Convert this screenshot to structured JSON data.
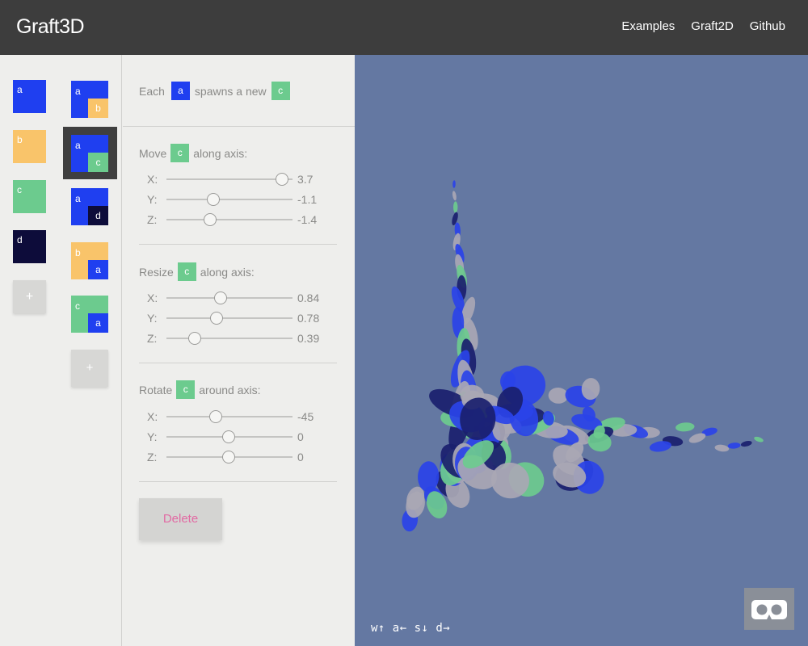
{
  "app": {
    "title": "Graft3D"
  },
  "nav": {
    "examples": "Examples",
    "graft2d": "Graft2D",
    "github": "Github"
  },
  "shapes": [
    {
      "label": "a",
      "color": "#1f3ff0"
    },
    {
      "label": "b",
      "color": "#f9c46a"
    },
    {
      "label": "c",
      "color": "#6ccb8e"
    },
    {
      "label": "d",
      "color": "#0d0c3a"
    }
  ],
  "add_shape_label": "+",
  "rules": [
    {
      "parent": "a",
      "child": "b"
    },
    {
      "parent": "a",
      "child": "c",
      "selected": true
    },
    {
      "parent": "a",
      "child": "d"
    },
    {
      "parent": "b",
      "child": "a"
    },
    {
      "parent": "c",
      "child": "a"
    }
  ],
  "add_rule_label": "+",
  "editor": {
    "each_text": "Each",
    "spawns_text": "spawns a new",
    "parent": "a",
    "child": "c",
    "move": {
      "title_pre": "Move",
      "title_post": "along axis:",
      "x": {
        "label": "X:",
        "value": "3.7"
      },
      "y": {
        "label": "Y:",
        "value": "-1.1"
      },
      "z": {
        "label": "Z:",
        "value": "-1.4"
      }
    },
    "resize": {
      "title_pre": "Resize",
      "title_post": "along axis:",
      "x": {
        "label": "X:",
        "value": "0.84"
      },
      "y": {
        "label": "Y:",
        "value": "0.78"
      },
      "z": {
        "label": "Z:",
        "value": "0.39"
      }
    },
    "rotate": {
      "title_pre": "Rotate",
      "title_post": "around axis:",
      "x": {
        "label": "X:",
        "value": "-45"
      },
      "y": {
        "label": "Y:",
        "value": "0"
      },
      "z": {
        "label": "Z:",
        "value": "0"
      }
    },
    "delete_label": "Delete"
  },
  "viewport": {
    "keys_hint": "w↑ a← s↓ d→",
    "vr_icon": "vr-headset-icon",
    "background": "#6478a2"
  },
  "colors": {
    "accent_blue": "#1f3ff0",
    "accent_yellow": "#f9c46a",
    "accent_green": "#6ccb8e",
    "accent_navy": "#0d0c3a",
    "delete_pink": "#e26aa3"
  }
}
